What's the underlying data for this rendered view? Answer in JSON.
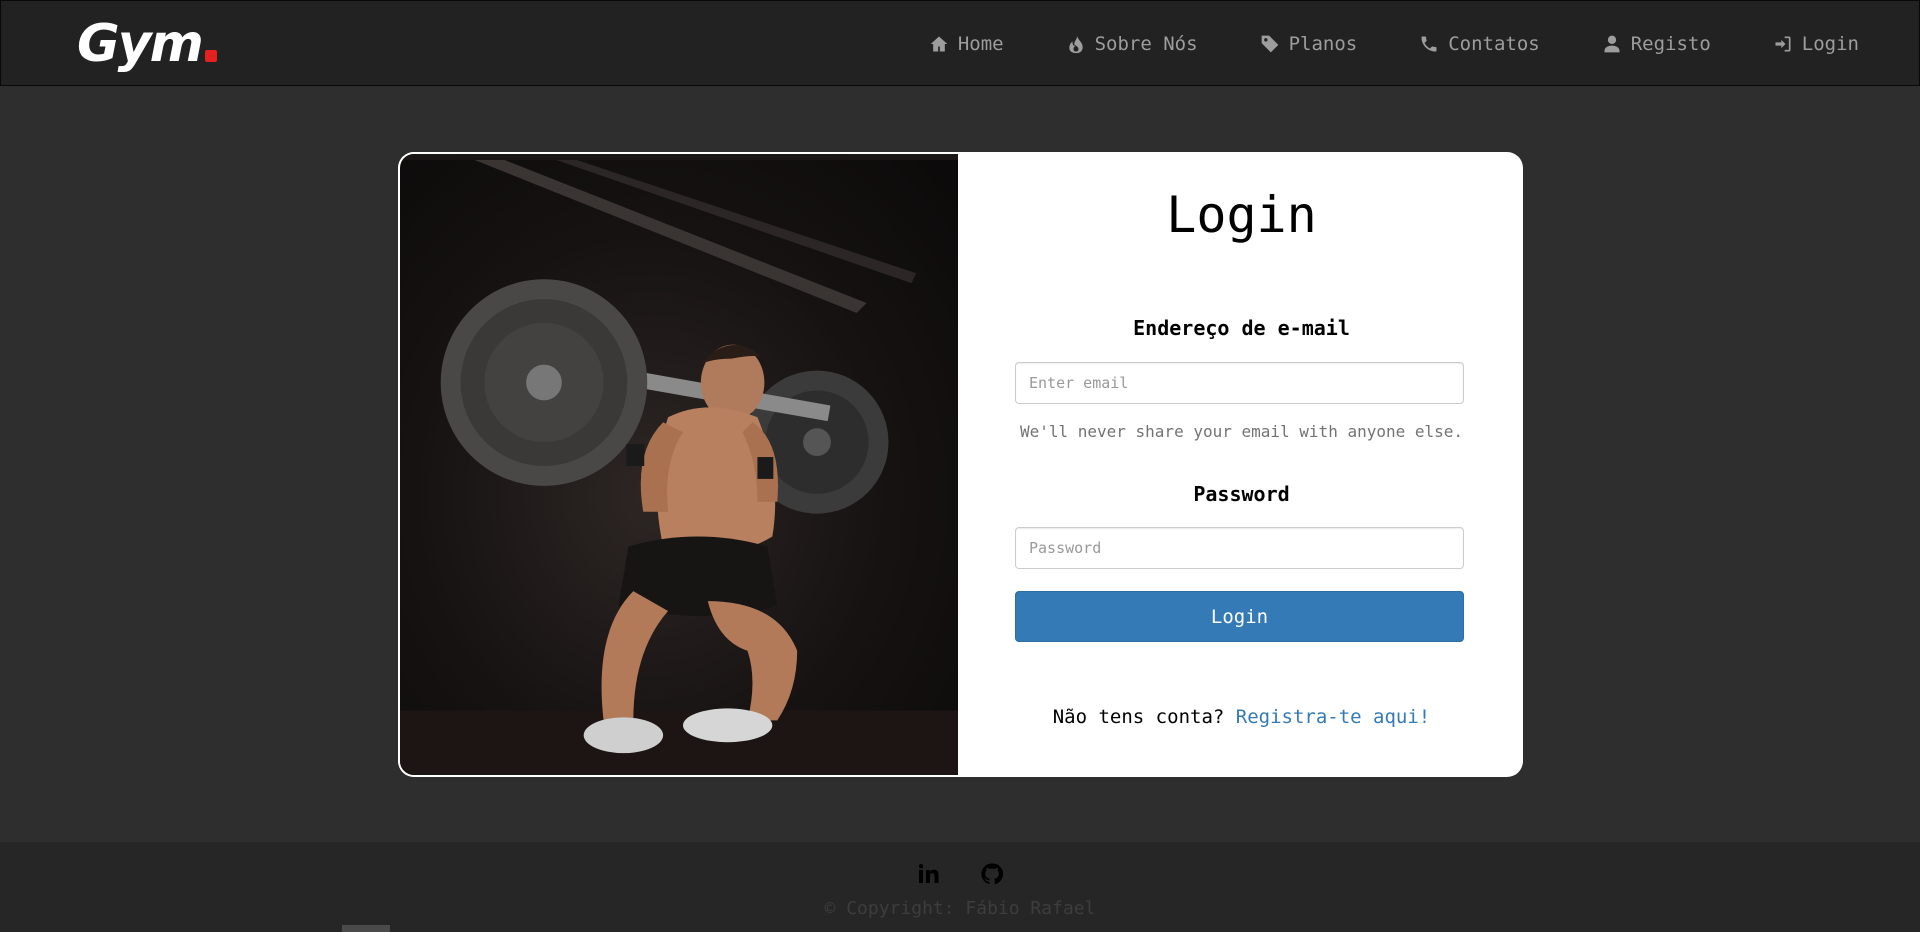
{
  "brand": {
    "name": "Gym",
    "accent_color": "#e52020"
  },
  "nav": {
    "items": [
      {
        "label": "Home",
        "icon": "home-icon"
      },
      {
        "label": "Sobre Nós",
        "icon": "fire-icon"
      },
      {
        "label": "Planos",
        "icon": "tag-icon"
      },
      {
        "label": "Contatos",
        "icon": "phone-icon"
      },
      {
        "label": "Registo",
        "icon": "user-icon"
      },
      {
        "label": "Login",
        "icon": "log-in-icon"
      }
    ]
  },
  "login": {
    "title": "Login",
    "email_label": "Endereço de e-mail",
    "email_placeholder": "Enter email",
    "email_help": "We'll never share your email with anyone else.",
    "password_label": "Password",
    "password_placeholder": "Password",
    "submit_label": "Login",
    "signup_prompt": "Não tens conta?",
    "signup_link": "Registra-te aqui!",
    "button_color": "#337ab7"
  },
  "footer": {
    "social": [
      "linkedin-icon",
      "github-icon"
    ],
    "copyright": "© Copyright: Fábio Rafael"
  }
}
